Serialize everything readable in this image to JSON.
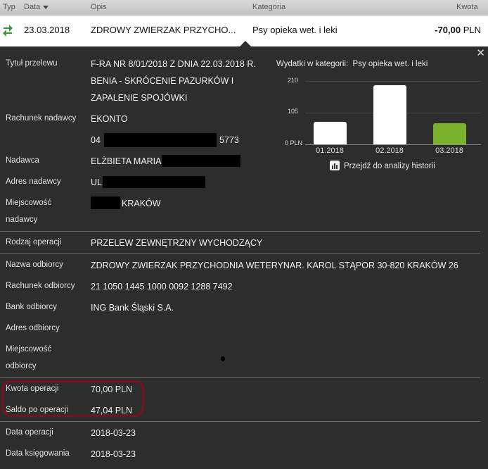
{
  "header": {
    "col_type": "Typ",
    "col_date": "Data",
    "col_desc": "Opis",
    "col_category": "Kategoria",
    "col_amount": "Kwota"
  },
  "transaction": {
    "date": "23.03.2018",
    "description": "ZDROWY ZWIERZAK PRZYCHO...",
    "category": "Psy opieka wet. i leki",
    "amount": "-70,00",
    "currency": "PLN",
    "icon": "transfer-arrows-icon"
  },
  "details": {
    "title_label": "Tytuł przelewu",
    "title_lines": [
      "F-RA NR 8/01/2018 Z DNIA 22.03.2018 R.",
      "BENIA - SKRÓCENIE PAZURKÓW I",
      "ZAPALENIE SPOJÓWKI"
    ],
    "sender_account_label": "Rachunek nadawcy",
    "sender_account_line1": "EKONTO",
    "sender_account_prefix": "04",
    "sender_account_suffix": "5773",
    "sender_label": "Nadawca",
    "sender_value": "ELŻBIETA MARIA",
    "sender_address_label": "Adres nadawcy",
    "sender_address_value": "UL",
    "sender_city_label_1": "Miejscowość",
    "sender_city_label_2": "nadawcy",
    "sender_city_value": "KRAKÓW",
    "op_type_label": "Rodzaj operacji",
    "op_type_value": "PRZELEW ZEWNĘTRZNY WYCHODZĄCY",
    "recipient_name_label": "Nazwa odbiorcy",
    "recipient_name_value": "ZDROWY ZWIERZAK PRZYCHODNIA WETERYNAR. KAROL STĄPOR 30-820 KRAKÓW 26",
    "recipient_account_label": "Rachunek odbiorcy",
    "recipient_account_value": "21 1050 1445 1000 0092 1288 7492",
    "recipient_bank_label": "Bank odbiorcy",
    "recipient_bank_value": "ING Bank Śląski S.A.",
    "recipient_address_label": "Adres odbiorcy",
    "recipient_city_label_1": "Miejscowość",
    "recipient_city_label_2": "odbiorcy",
    "amount_label": "Kwota operacji",
    "amount_value": "70,00 PLN",
    "balance_label": "Saldo po operacji",
    "balance_value": "47,04 PLN",
    "op_date_label": "Data operacji",
    "op_date_value": "2018-03-23",
    "booking_date_label": "Data księgowania",
    "booking_date_value": "2018-03-23"
  },
  "chart_header": {
    "prefix": "Wydatki w kategorii:",
    "category": "Psy opieka wet. i leki",
    "history_link": "Przejdź do analizy historii"
  },
  "chart_data": {
    "type": "bar",
    "title": "Wydatki w kategorii: Psy opieka wet. i leki",
    "categories": [
      "01.2018",
      "02.2018",
      "03.2018"
    ],
    "values": [
      75,
      195,
      70
    ],
    "y_ticks": [
      "210",
      "105",
      "0 PLN"
    ],
    "ylim": [
      0,
      210
    ],
    "bar_colors": [
      "#ffffff",
      "#ffffff",
      "#7ab22e"
    ]
  }
}
